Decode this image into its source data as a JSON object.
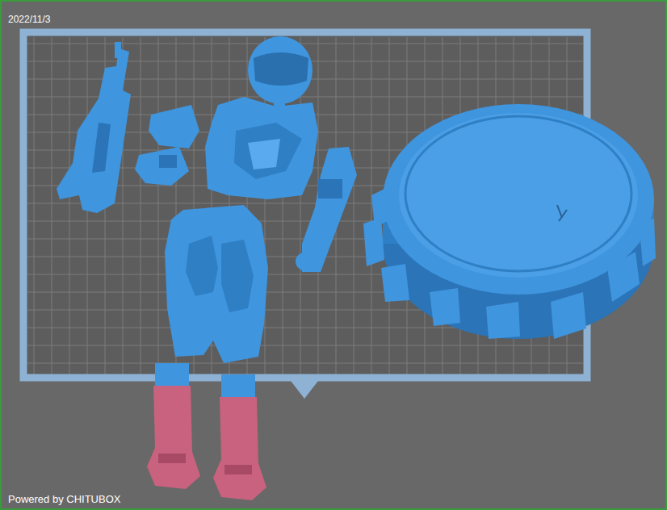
{
  "viewport": {
    "timestamp": "2022/11/3",
    "watermark": "Powered by CHITUBOX"
  },
  "parts": [
    {
      "kind": "rifle",
      "outside_plate": false,
      "color": "#3f95de"
    },
    {
      "kind": "helmet",
      "outside_plate": false,
      "color": "#3f95de"
    },
    {
      "kind": "torso",
      "outside_plate": false,
      "color": "#3f95de"
    },
    {
      "kind": "left-arm",
      "outside_plate": false,
      "color": "#3f95de"
    },
    {
      "kind": "right-arm",
      "outside_plate": false,
      "color": "#3f95de"
    },
    {
      "kind": "legs",
      "outside_plate": false,
      "color": "#3f95de"
    },
    {
      "kind": "left-boot",
      "outside_plate": true,
      "color": "#c9627e"
    },
    {
      "kind": "right-boot",
      "outside_plate": true,
      "color": "#c9627e"
    },
    {
      "kind": "base",
      "outside_plate": false,
      "color": "#3f95de"
    }
  ]
}
